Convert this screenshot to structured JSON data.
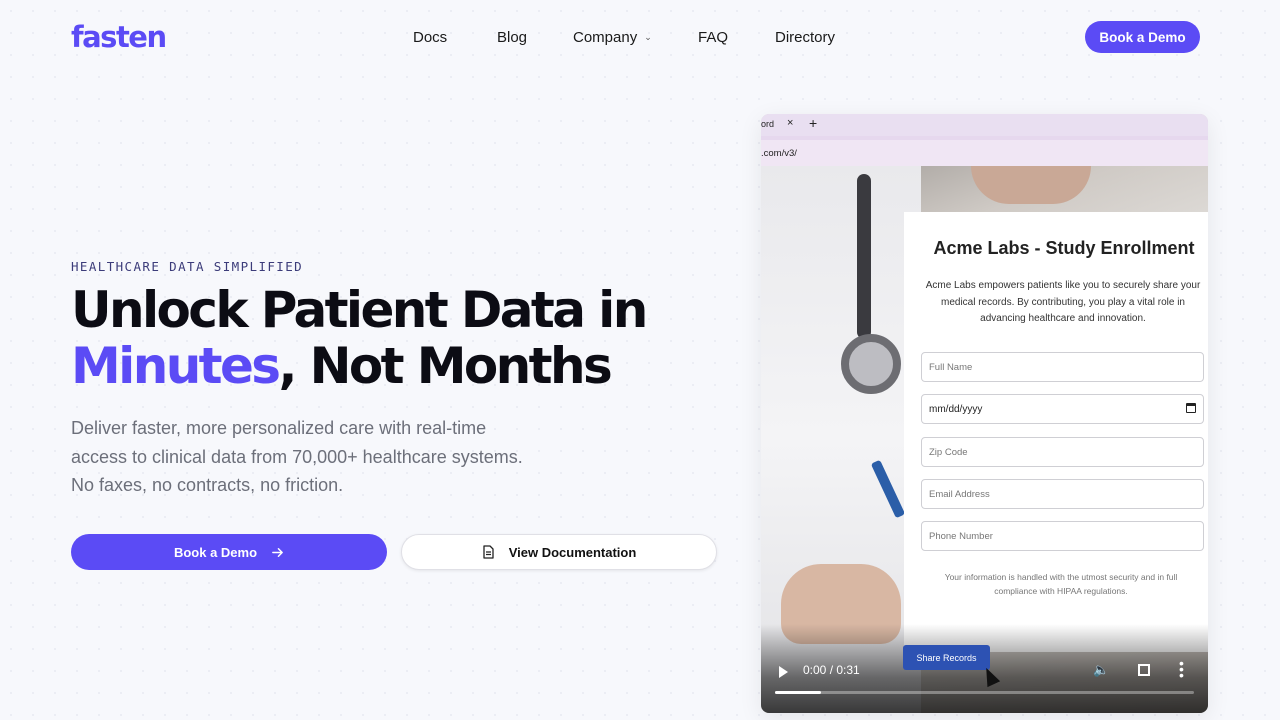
{
  "nav": {
    "logo": "fasten",
    "links": [
      "Docs",
      "Blog",
      "Company",
      "FAQ",
      "Directory"
    ],
    "cta": "Book a Demo"
  },
  "hero": {
    "eyebrow": "HEALTHCARE DATA SIMPLIFIED",
    "headline_line1": "Unlock Patient Data in",
    "headline_accent": "Minutes",
    "headline_rest": ", Not Months",
    "subtext": "Deliver faster, more personalized care with real-time access to clinical data from 70,000+ healthcare systems. No faxes, no contracts, no friction.",
    "primary_cta": "Book a Demo",
    "secondary_cta": "View Documentation"
  },
  "video": {
    "tab_text": "ord",
    "url_text": ".com/v3/",
    "form": {
      "title": "Acme Labs - Study Enrollment",
      "description": "Acme Labs empowers patients like you to securely share your medical records. By contributing, you play a vital role in advancing healthcare and innovation.",
      "fields": {
        "full_name": "Full Name",
        "dob": "mm/dd/yyyy",
        "zip": "Zip Code",
        "email": "Email Address",
        "phone": "Phone Number"
      },
      "note": "Your information is handled with the utmost security and in full compliance with HIPAA regulations.",
      "submit": "Share Records"
    },
    "time": "0:00 / 0:31",
    "progress": 0.11
  },
  "colors": {
    "brand": "#5b4bf5"
  }
}
